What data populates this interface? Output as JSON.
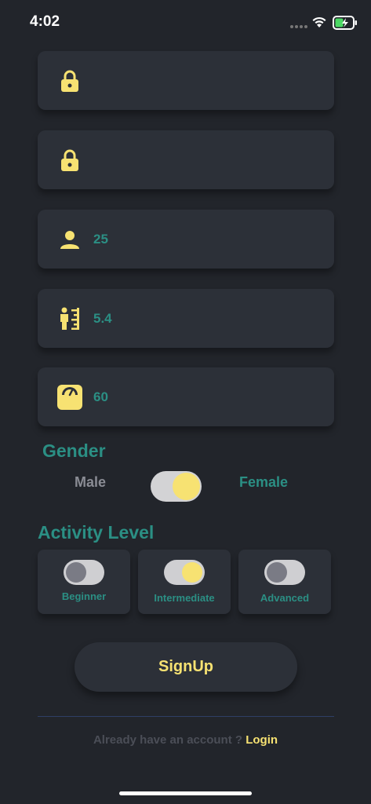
{
  "status_bar": {
    "time": "4:02"
  },
  "fields": [
    {
      "icon": "lock-icon",
      "value": ""
    },
    {
      "icon": "lock-icon",
      "value": ""
    },
    {
      "icon": "person-icon",
      "value": "25"
    },
    {
      "icon": "height-icon",
      "value": "5.4"
    },
    {
      "icon": "weight-scale-icon",
      "value": "60"
    }
  ],
  "gender": {
    "title": "Gender",
    "male_label": "Male",
    "female_label": "Female",
    "selected": "Female"
  },
  "activity": {
    "title": "Activity Level",
    "options": [
      {
        "label": "Beginner",
        "on": false
      },
      {
        "label": "Intermediate",
        "on": true
      },
      {
        "label": "Advanced",
        "on": false
      }
    ]
  },
  "signup": {
    "label": "SignUp"
  },
  "login": {
    "prompt": "Already have an account ? ",
    "link": "Login"
  },
  "colors": {
    "background": "#22252b",
    "card": "#2c3038",
    "accent": "#f7e272",
    "teal": "#2b8f84"
  }
}
